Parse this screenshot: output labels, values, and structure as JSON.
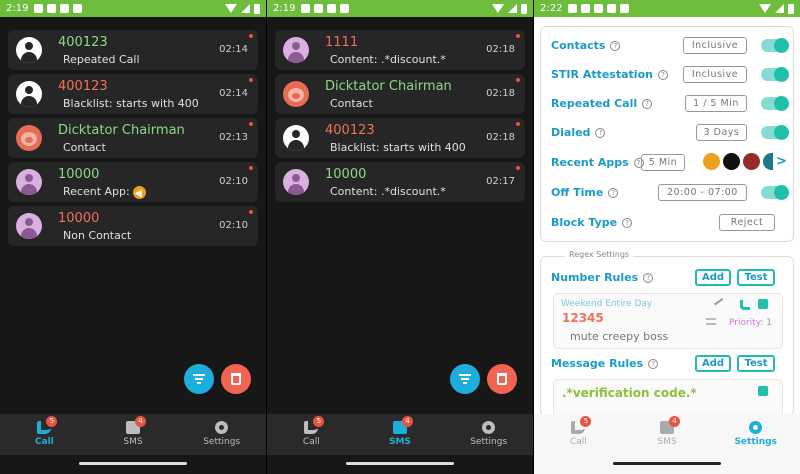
{
  "panels": [
    {
      "status_time": "2:19",
      "items": [
        {
          "number": "400123",
          "number_color": "green",
          "detail": "Repeated Call",
          "time": "02:14",
          "avatar": "default"
        },
        {
          "number": "400123",
          "number_color": "red",
          "detail": "Blacklist: starts with 400",
          "time": "02:14",
          "avatar": "default"
        },
        {
          "number": "Dicktator Chairman",
          "number_color": "green",
          "detail": "Contact",
          "time": "02:13",
          "avatar": "pig"
        },
        {
          "number": "10000",
          "number_color": "green",
          "detail": "Recent App:",
          "time": "02:10",
          "avatar": "purple"
        },
        {
          "number": "10000",
          "number_color": "red",
          "detail": "Non Contact",
          "time": "02:10",
          "avatar": "purple"
        }
      ],
      "nav": [
        {
          "label": "Call",
          "badge": "5",
          "active": true
        },
        {
          "label": "SMS",
          "badge": "4",
          "active": false
        },
        {
          "label": "Settings",
          "badge": "",
          "active": false
        }
      ]
    },
    {
      "status_time": "2:19",
      "items": [
        {
          "number": "1111",
          "number_color": "red",
          "detail": "Content: .*discount.*",
          "time": "02:18",
          "avatar": "purple"
        },
        {
          "number": "Dicktator Chairman",
          "number_color": "green",
          "detail": "Contact",
          "time": "02:18",
          "avatar": "pig"
        },
        {
          "number": "400123",
          "number_color": "red",
          "detail": "Blacklist: starts with 400",
          "time": "02:18",
          "avatar": "default"
        },
        {
          "number": "10000",
          "number_color": "green",
          "detail": "Content: .*discount.*",
          "time": "02:17",
          "avatar": "purple"
        }
      ],
      "nav": [
        {
          "label": "Call",
          "badge": "5",
          "active": false
        },
        {
          "label": "SMS",
          "badge": "4",
          "active": true
        },
        {
          "label": "Settings",
          "badge": "",
          "active": false
        }
      ]
    }
  ],
  "settings": {
    "status_time": "2:22",
    "rows": {
      "contacts": {
        "label": "Contacts",
        "value": "Inclusive"
      },
      "stir": {
        "label": "STIR Attestation",
        "value": "Inclusive"
      },
      "repeated": {
        "label": "Repeated Call",
        "value": "1 / 5 Min"
      },
      "dialed": {
        "label": "Dialed",
        "value": "3 Days"
      },
      "recent": {
        "label": "Recent Apps",
        "value": "5 Min"
      },
      "offtime": {
        "label": "Off Time",
        "value": "20:00 - 07:00"
      },
      "blocktype": {
        "label": "Block Type",
        "value": "Reject"
      }
    },
    "regex": {
      "legend": "Regex Settings",
      "number_rules": "Number Rules",
      "message_rules": "Message Rules",
      "add": "Add",
      "test": "Test",
      "rule1": {
        "tags": "Weekend  Entire Day",
        "pattern": "12345",
        "desc": "mute creepy boss",
        "priority": "Priority: 1"
      },
      "rule2": {
        "pattern": ".*verification code.*"
      }
    },
    "nav": [
      {
        "label": "Call",
        "badge": "5",
        "active": false
      },
      {
        "label": "SMS",
        "badge": "4",
        "active": false
      },
      {
        "label": "Settings",
        "badge": "",
        "active": true
      }
    ],
    "colors": {
      "accent": "#1eaedb",
      "toggle": "#1fbfa9",
      "status_bar": "#6fbd3d",
      "red": "#f2705a",
      "green": "#8fd88a"
    }
  }
}
